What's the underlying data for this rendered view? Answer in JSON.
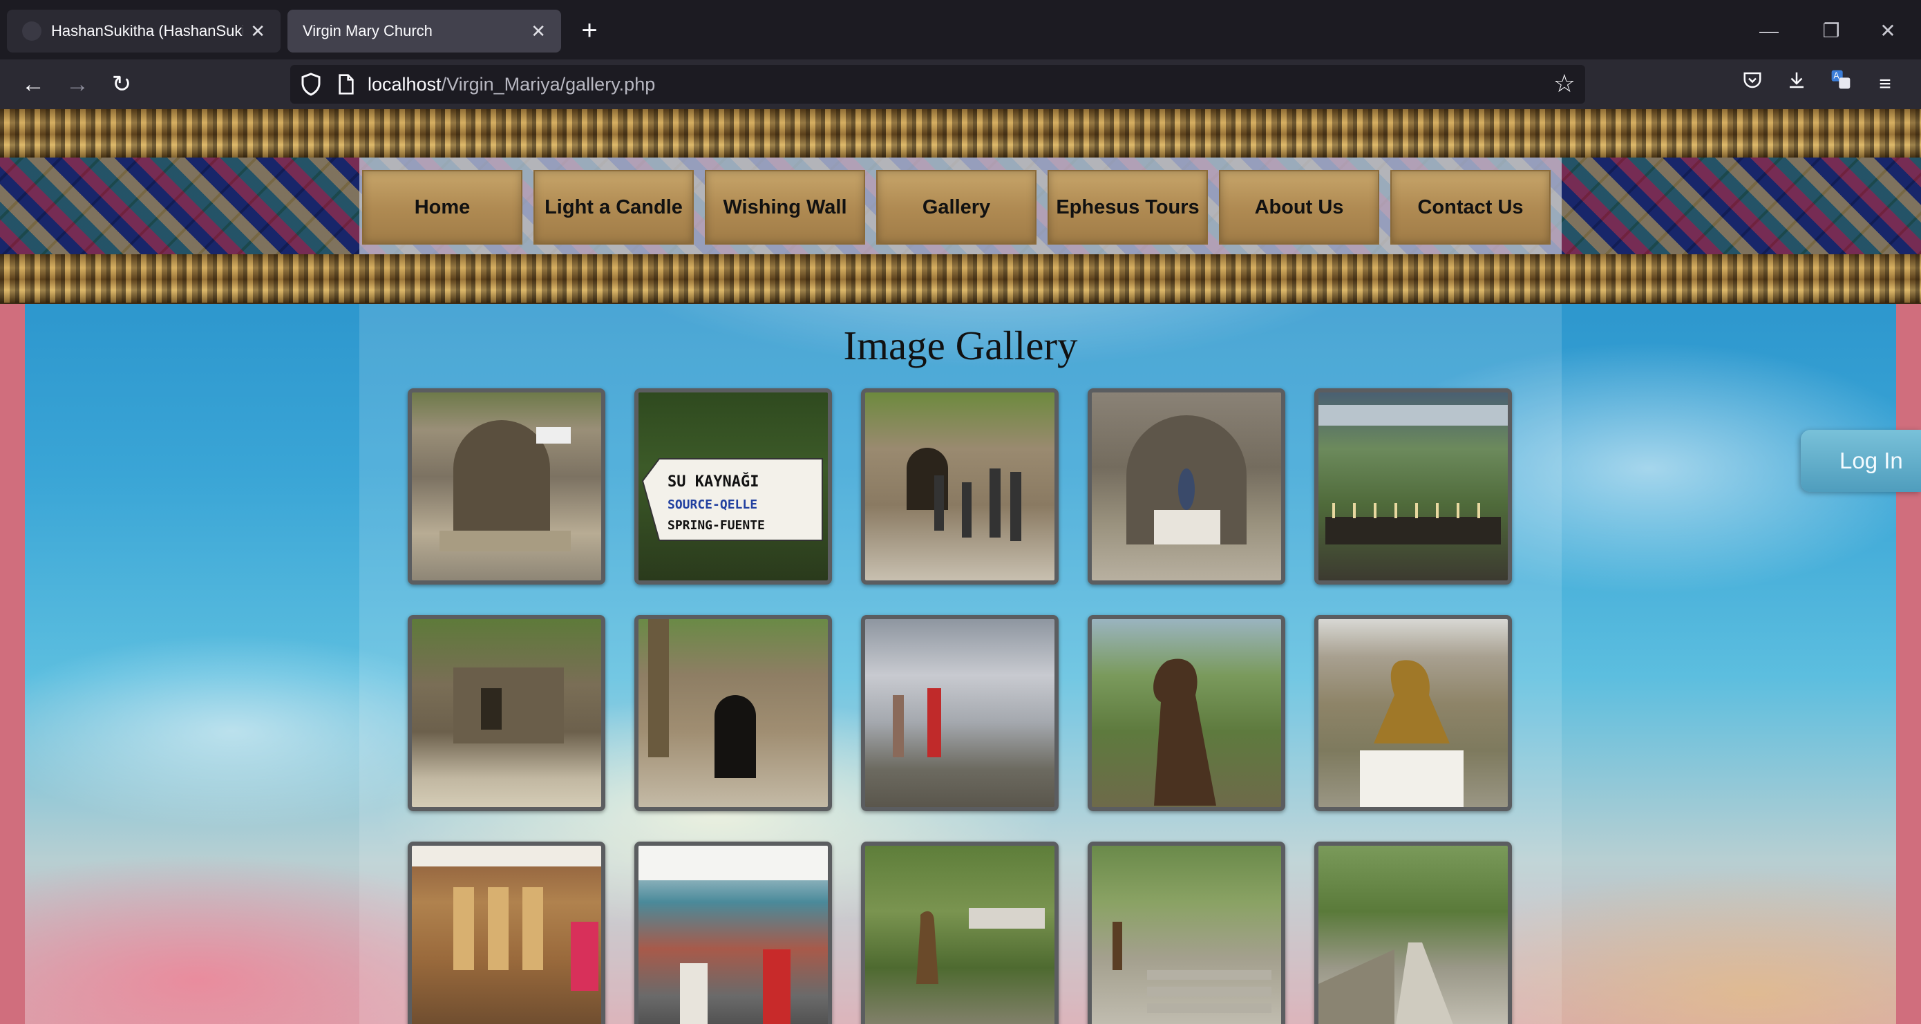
{
  "browser": {
    "tabs": [
      {
        "title": "HashanSukitha (HashanSukitha",
        "active": false
      },
      {
        "title": "Virgin Mary Church",
        "active": true
      }
    ],
    "url": {
      "host": "localhost",
      "path": "/Virgin_Mariya/gallery.php"
    },
    "icons": {
      "back": "arrow-left-icon",
      "forward": "arrow-right-icon",
      "reload": "reload-icon",
      "shield": "shield-icon",
      "page": "page-icon",
      "bookmark": "star-icon",
      "pocket": "pocket-icon",
      "downloads": "download-icon",
      "translate": "translate-icon",
      "menu": "hamburger-menu-icon",
      "newtab": "plus-icon",
      "minimize": "minimize-icon",
      "restore": "restore-icon",
      "close": "close-icon"
    }
  },
  "site": {
    "nav": [
      "Home",
      "Light a Candle",
      "Wishing Wall",
      "Gallery",
      "Ephesus Tours",
      "About Us",
      "Contact Us"
    ],
    "gallery_title": "Image Gallery",
    "login_label": "Log In",
    "gallery_rows": [
      [
        "stone-spring-fountain-photo",
        "su-kaynagi-sign-photo",
        "visitors-at-house-photo",
        "shrine-interior-photo",
        "candle-stand-photo"
      ],
      [
        "stone-ruins-photo",
        "arched-doorway-photo",
        "wishing-wall-photo",
        "bronze-statue-photo",
        "golden-statue-photo"
      ],
      [
        "souvenir-shop-photo",
        "gift-stall-photo",
        "garden-statue-photo",
        "stone-steps-photo",
        "garden-path-photo"
      ]
    ],
    "sign_text": [
      "SU KAYNAĞI",
      "SOURCE-QELLE",
      "SPRING-FUENTE"
    ]
  }
}
